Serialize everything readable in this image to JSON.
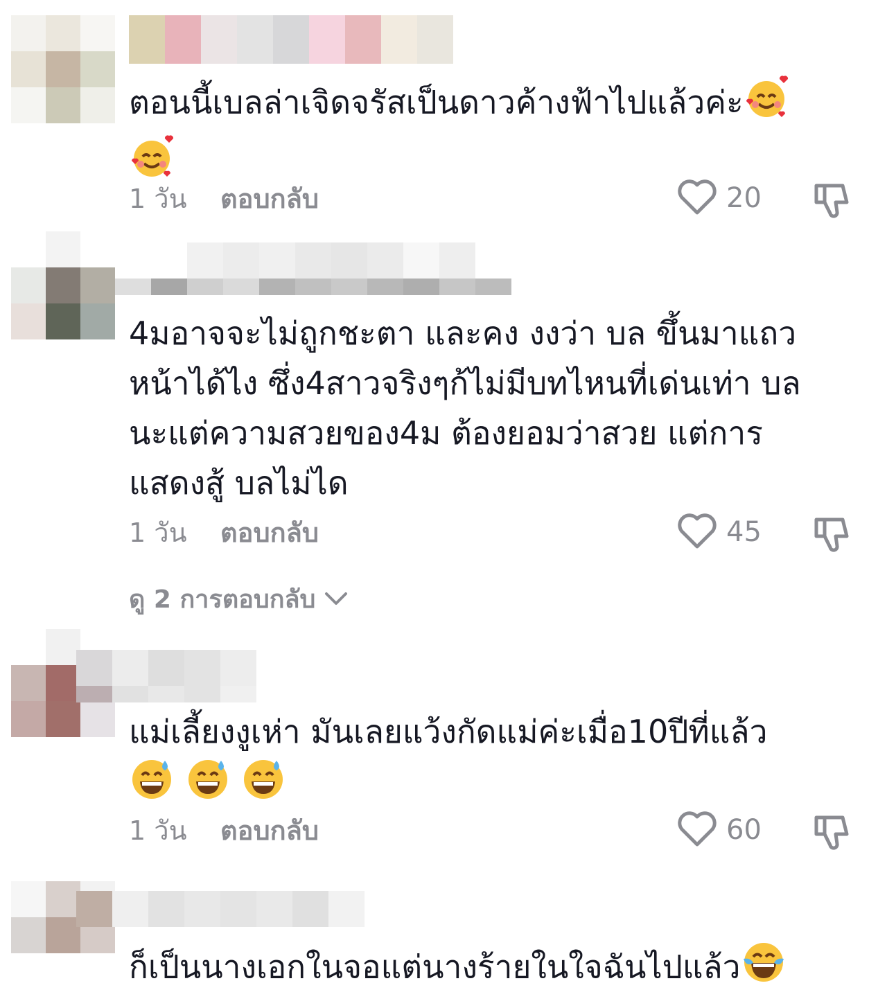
{
  "comments": [
    {
      "text": "ตอนนี้เบลล่าเจิดจรัสเป็นดาวค้างฟ้าไปแล้วค่ะ",
      "emoji_after": [
        "smiling-face-with-hearts",
        "smiling-face-with-hearts"
      ],
      "time": "1 วัน",
      "reply": "ตอบกลับ",
      "likes": "20"
    },
    {
      "text": "4มอาจจะไม่ถูกชะตา และคง งงว่า บล ขึ้นมาแถว\nหน้าได้ไง ซึ่ง4สาวจริงๆก้ไม่มีบทไหนที่เด่นเท่า บล\nนะแต่ความสวยของ4ม ต้องยอมว่าสวย แต่การ\nแสดงสู้ บลไม่ได",
      "time": "1 วัน",
      "reply": "ตอบกลับ",
      "likes": "45",
      "view_replies": "ดู 2 การตอบกลับ"
    },
    {
      "text": "แม่เลี้ยงงูเห่า มันเลยแว้งกัดแม่ค่ะเมื่อ10ปีที่แล้ว",
      "emoji_after": [
        "grinning-face-with-sweat",
        "grinning-face-with-sweat",
        "grinning-face-with-sweat"
      ],
      "time": "1 วัน",
      "reply": "ตอบกลับ",
      "likes": "60"
    },
    {
      "text": "ก็เป็นนางเอกในจอแต่นางร้ายในใจฉันไปแล้ว",
      "emoji_after": [
        "face-with-tears-of-joy"
      ]
    }
  ],
  "colors": {
    "text": "#161823",
    "secondary": "#8a8b91"
  }
}
